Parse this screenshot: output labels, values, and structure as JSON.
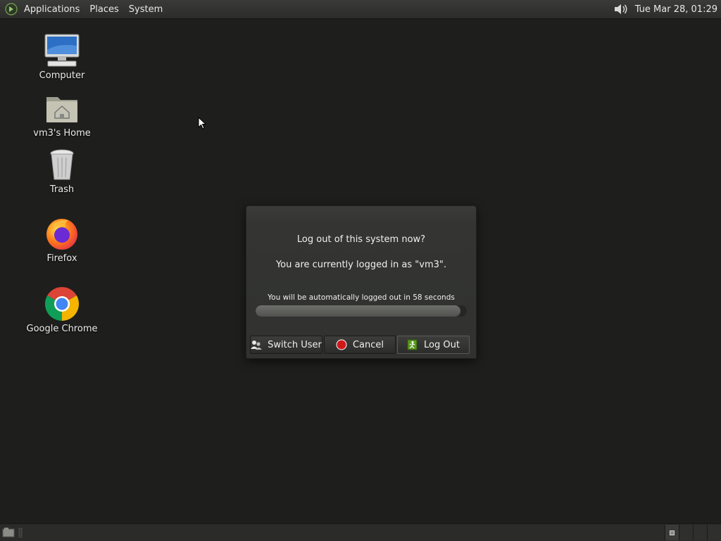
{
  "top_panel": {
    "menus": [
      "Applications",
      "Places",
      "System"
    ],
    "clock": "Tue Mar 28, 01:29",
    "logo_icon": "gnome-foot-icon",
    "volume_icon": "speaker-icon"
  },
  "desktop": {
    "icons": [
      {
        "label": "Computer",
        "icon": "computer-icon"
      },
      {
        "label": "vm3's Home",
        "icon": "home-folder-icon"
      },
      {
        "label": "Trash",
        "icon": "trash-icon"
      },
      {
        "label": "Firefox",
        "icon": "firefox-icon"
      },
      {
        "label": "Google Chrome",
        "icon": "chrome-icon"
      }
    ]
  },
  "dialog": {
    "title": "Log out of this system now?",
    "subtitle": "You are currently logged in as \"vm3\".",
    "countdown": "You will be automatically logged out in 58 seconds",
    "progress_fraction": 0.97,
    "buttons": {
      "switch_user": "Switch User",
      "cancel": "Cancel",
      "log_out": "Log Out"
    }
  },
  "colors": {
    "desktop_bg": "#1e1f1d",
    "cancel_red": "#d0181b",
    "logout_green": "#5a9a1e"
  }
}
